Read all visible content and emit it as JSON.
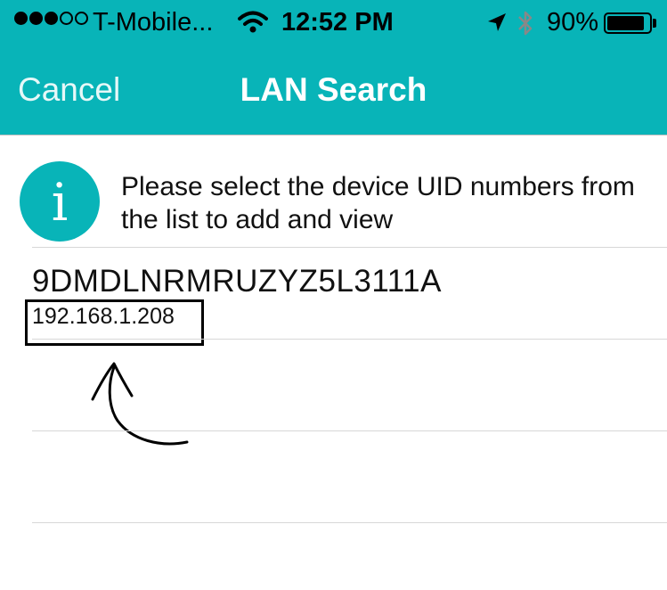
{
  "status_bar": {
    "carrier": "T-Mobile...",
    "time": "12:52 PM",
    "battery_percent": "90%",
    "battery_level": 0.9,
    "signal_bars_filled": 3,
    "signal_bars_total": 5
  },
  "nav": {
    "cancel_label": "Cancel",
    "title": "LAN Search"
  },
  "info": {
    "icon_glyph": "i",
    "message": "Please select the device UID numbers from the list to add and view"
  },
  "devices": [
    {
      "uid": "9DMDLNRMRUZYZ5L3111A",
      "ip": "192.168.1.208"
    }
  ],
  "colors": {
    "accent": "#08b4b8",
    "text": "#111111",
    "divider": "#d7d7d7"
  }
}
